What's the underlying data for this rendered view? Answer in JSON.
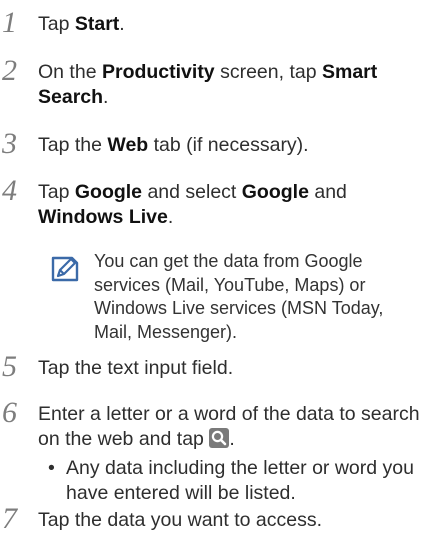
{
  "steps": [
    {
      "num": "1",
      "pre": "Tap ",
      "b1": "Start",
      "post": "."
    },
    {
      "num": "2",
      "pre": "On the ",
      "b1": "Productivity",
      "mid": " screen, tap ",
      "b2": "Smart Search",
      "post": "."
    },
    {
      "num": "3",
      "pre": "Tap the ",
      "b1": "Web",
      "post": " tab (if necessary)."
    },
    {
      "num": "4",
      "pre": "Tap ",
      "b1": "Google",
      "mid": " and select ",
      "b2": "Google",
      "mid2": " and ",
      "b3": "Windows Live",
      "post": "."
    },
    {
      "num": "5",
      "text": "Tap the text input field."
    },
    {
      "num": "6",
      "pre": "Enter a letter or a word of the data to search on the web and tap ",
      "post": "."
    },
    {
      "num": "7",
      "text": "Tap the data you want to access."
    }
  ],
  "note": {
    "icon": "note-pencil-icon",
    "text": "You can get the data from Google services (Mail, YouTube, Maps) or Windows Live services (MSN Today, Mail, Messenger)."
  },
  "bullet": {
    "dot": "•",
    "text": "Any data including the letter or word you have entered will be listed."
  },
  "icons": {
    "search": "search-icon"
  },
  "colors": {
    "step_number": "#7d7d7d",
    "body_text": "#2e2e2e",
    "search_icon_bg": "#7a7a7a"
  }
}
